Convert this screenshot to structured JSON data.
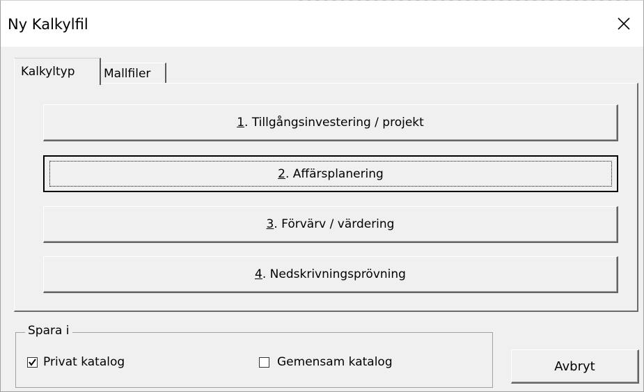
{
  "window": {
    "title": "Ny Kalkylfil",
    "close_glyph": "✕"
  },
  "tabs": [
    {
      "label": "Kalkyltyp",
      "active": true
    },
    {
      "label": "Mallfiler",
      "active": false
    }
  ],
  "options": [
    {
      "accel": "1",
      "rest": ". Tillgångsinvestering / projekt"
    },
    {
      "accel": "2",
      "rest": ". Affärsplanering",
      "focused": true
    },
    {
      "accel": "3",
      "rest": ". Förvärv / värdering"
    },
    {
      "accel": "4",
      "rest": ". Nedskrivningsprövning"
    }
  ],
  "save": {
    "legend": "Spara i",
    "private": {
      "label": "Privat katalog",
      "checked": true
    },
    "shared": {
      "label": "Gemensam katalog",
      "checked": false
    }
  },
  "cancel_label": "Avbryt",
  "colors": {
    "window_bg": "#f0f0f0",
    "titlebar_bg": "#ffffff"
  },
  "icons": {
    "close": "close-icon",
    "check": "check-icon"
  }
}
